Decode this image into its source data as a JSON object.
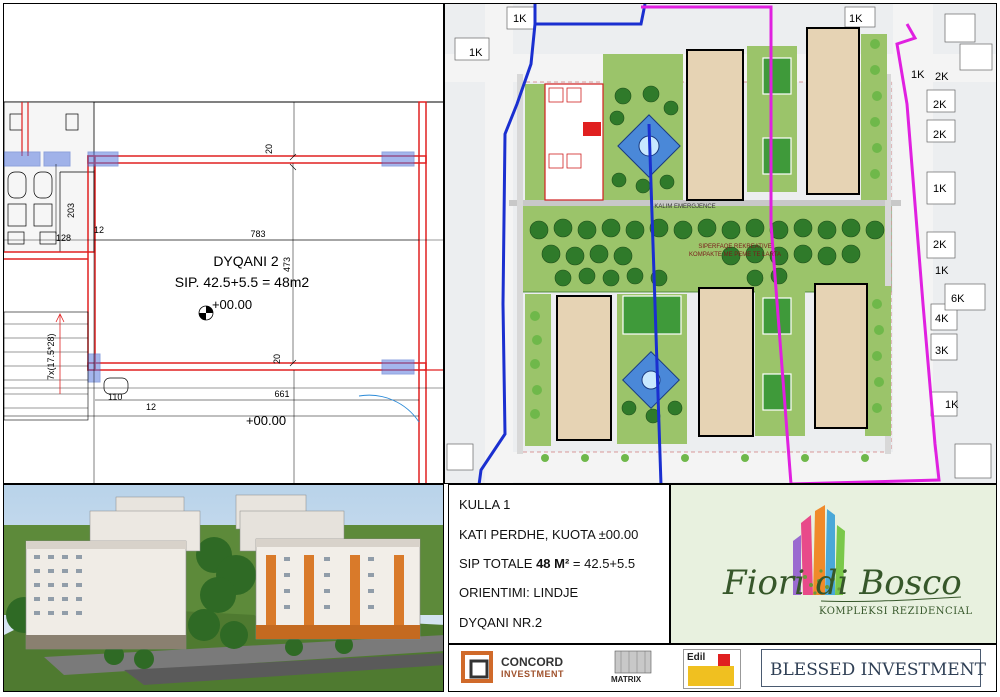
{
  "plan": {
    "room_name": "DYQANI 2",
    "room_area": "SIP. 42.5+5.5 = 48m2",
    "level_mark": "+00.00",
    "level_mark_lower": "+00.00",
    "dims": {
      "d20_top": "20",
      "d20_mid": "20",
      "d783": "783",
      "d473": "473",
      "d661": "661",
      "d12_a": "12",
      "d12_b": "12",
      "d128": "128",
      "d203": "203",
      "d110": "110",
      "stair": "7x(17.5*28)"
    }
  },
  "site": {
    "labels": {
      "k1": "1K",
      "k2": "2K",
      "k4": "4K",
      "k3": "3K",
      "k6": "6K"
    },
    "green_text_1": "SIPERFAQE REKREATIVE",
    "green_text_2": "KOMPAKTE ME PEME TE LARTA",
    "road_text": "KALIM EMERGJENCE"
  },
  "info": {
    "line1": "KULLA 1",
    "line2": "KATI PERDHE, KUOTA ±00.00",
    "line3_prefix": "SIP TOTALE ",
    "line3_bold": "48 M²",
    "line3_suffix": " = 42.5+5.5",
    "line4": "ORIENTIMI: LINDJE",
    "line5": "DYQANI NR.2"
  },
  "logo": {
    "name": "Fiori di Bosco",
    "subtitle": "KOMPLEKSI REZIDENCIAL"
  },
  "sponsors": {
    "concord": "CONCORD",
    "concord_sub": "INVESTMENT",
    "matrix": "MATRIX",
    "edil": "Edil",
    "blessed": "BLESSED INVESTMENT"
  },
  "colors": {
    "wall_red": "#e02020",
    "plan_blue": "#3a5fc8",
    "site_green": "#9bc46a",
    "tree_green": "#2f7a2a",
    "boundary_blue": "#1a2fd0",
    "boundary_magenta": "#e020e0",
    "building_tan": "#e6d3b4",
    "logo_green": "#36572a"
  }
}
